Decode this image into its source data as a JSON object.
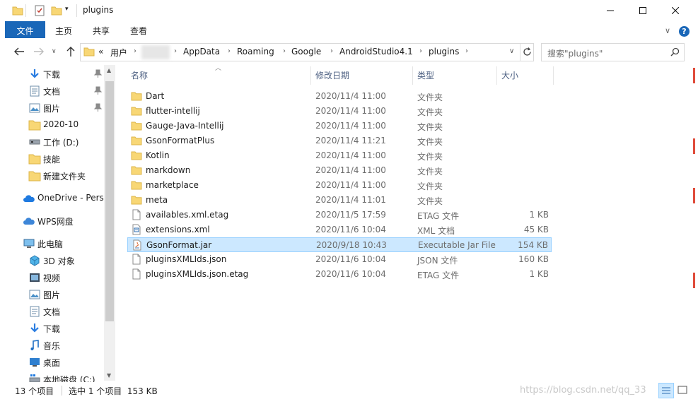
{
  "window": {
    "title": "plugins"
  },
  "ribbon": {
    "tabs": [
      "文件",
      "主页",
      "共享",
      "查看"
    ]
  },
  "address": {
    "overflow": "«",
    "crumbs": [
      "用户",
      "AppData",
      "Roaming",
      "Google",
      "AndroidStudio4.1",
      "plugins"
    ]
  },
  "search": {
    "placeholder": "搜索\"plugins\""
  },
  "sidebar": {
    "items": [
      {
        "label": "下载",
        "icon": "download-arrow-icon",
        "pinned": true
      },
      {
        "label": "文档",
        "icon": "document-icon",
        "pinned": true
      },
      {
        "label": "图片",
        "icon": "picture-icon",
        "pinned": true
      },
      {
        "label": "2020-10",
        "icon": "folder-icon",
        "pinned": false
      },
      {
        "label": "工作 (D:)",
        "icon": "drive-icon",
        "pinned": false
      },
      {
        "label": "技能",
        "icon": "folder-icon",
        "pinned": false
      },
      {
        "label": "新建文件夹",
        "icon": "folder-icon",
        "pinned": false
      },
      {
        "label": "OneDrive - Perso",
        "icon": "onedrive-cloud-icon",
        "pinned": false
      },
      {
        "label": "WPS网盘",
        "icon": "wps-cloud-icon",
        "pinned": false
      },
      {
        "label": "此电脑",
        "icon": "computer-icon",
        "pinned": false
      },
      {
        "label": "3D 对象",
        "icon": "3d-objects-icon",
        "pinned": false
      },
      {
        "label": "视频",
        "icon": "video-icon",
        "pinned": false
      },
      {
        "label": "图片",
        "icon": "picture-icon",
        "pinned": false
      },
      {
        "label": "文档",
        "icon": "document-icon",
        "pinned": false
      },
      {
        "label": "下载",
        "icon": "download-arrow-icon",
        "pinned": false
      },
      {
        "label": "音乐",
        "icon": "music-icon",
        "pinned": false
      },
      {
        "label": "桌面",
        "icon": "desktop-icon",
        "pinned": false
      },
      {
        "label": "本地磁盘 (C:)",
        "icon": "windows-drive-icon",
        "pinned": false
      }
    ]
  },
  "columns": {
    "name": "名称",
    "date": "修改日期",
    "type": "类型",
    "size": "大小"
  },
  "files": [
    {
      "name": "Dart",
      "date": "2020/11/4 11:00",
      "type": "文件夹",
      "size": "",
      "icon": "folder-icon"
    },
    {
      "name": "flutter-intellij",
      "date": "2020/11/4 11:00",
      "type": "文件夹",
      "size": "",
      "icon": "folder-icon"
    },
    {
      "name": "Gauge-Java-Intellij",
      "date": "2020/11/4 11:00",
      "type": "文件夹",
      "size": "",
      "icon": "folder-icon"
    },
    {
      "name": "GsonFormatPlus",
      "date": "2020/11/4 11:21",
      "type": "文件夹",
      "size": "",
      "icon": "folder-icon"
    },
    {
      "name": "Kotlin",
      "date": "2020/11/4 11:00",
      "type": "文件夹",
      "size": "",
      "icon": "folder-icon"
    },
    {
      "name": "markdown",
      "date": "2020/11/4 11:00",
      "type": "文件夹",
      "size": "",
      "icon": "folder-icon"
    },
    {
      "name": "marketplace",
      "date": "2020/11/4 11:00",
      "type": "文件夹",
      "size": "",
      "icon": "folder-icon"
    },
    {
      "name": "meta",
      "date": "2020/11/4 11:01",
      "type": "文件夹",
      "size": "",
      "icon": "folder-icon"
    },
    {
      "name": "availables.xml.etag",
      "date": "2020/11/5 17:59",
      "type": "ETAG 文件",
      "size": "1 KB",
      "icon": "file-icon"
    },
    {
      "name": "extensions.xml",
      "date": "2020/11/6 10:04",
      "type": "XML 文档",
      "size": "45 KB",
      "icon": "xml-file-icon"
    },
    {
      "name": "GsonFormat.jar",
      "date": "2020/9/18 10:43",
      "type": "Executable Jar File",
      "size": "154 KB",
      "icon": "jar-file-icon",
      "selected": true
    },
    {
      "name": "pluginsXMLIds.json",
      "date": "2020/11/6 10:04",
      "type": "JSON 文件",
      "size": "160 KB",
      "icon": "file-icon"
    },
    {
      "name": "pluginsXMLIds.json.etag",
      "date": "2020/11/6 10:04",
      "type": "ETAG 文件",
      "size": "1 KB",
      "icon": "file-icon"
    }
  ],
  "status": {
    "count": "13 个项目",
    "selection": "选中 1 个项目  153 KB"
  },
  "watermark": "https://blog.csdn.net/qq_33",
  "colors": {
    "accent": "#1a67b8",
    "selection_bg": "#cce8ff",
    "selection_border": "#99d1ff",
    "folder": "#f8d775",
    "header_text": "#4d6082"
  }
}
